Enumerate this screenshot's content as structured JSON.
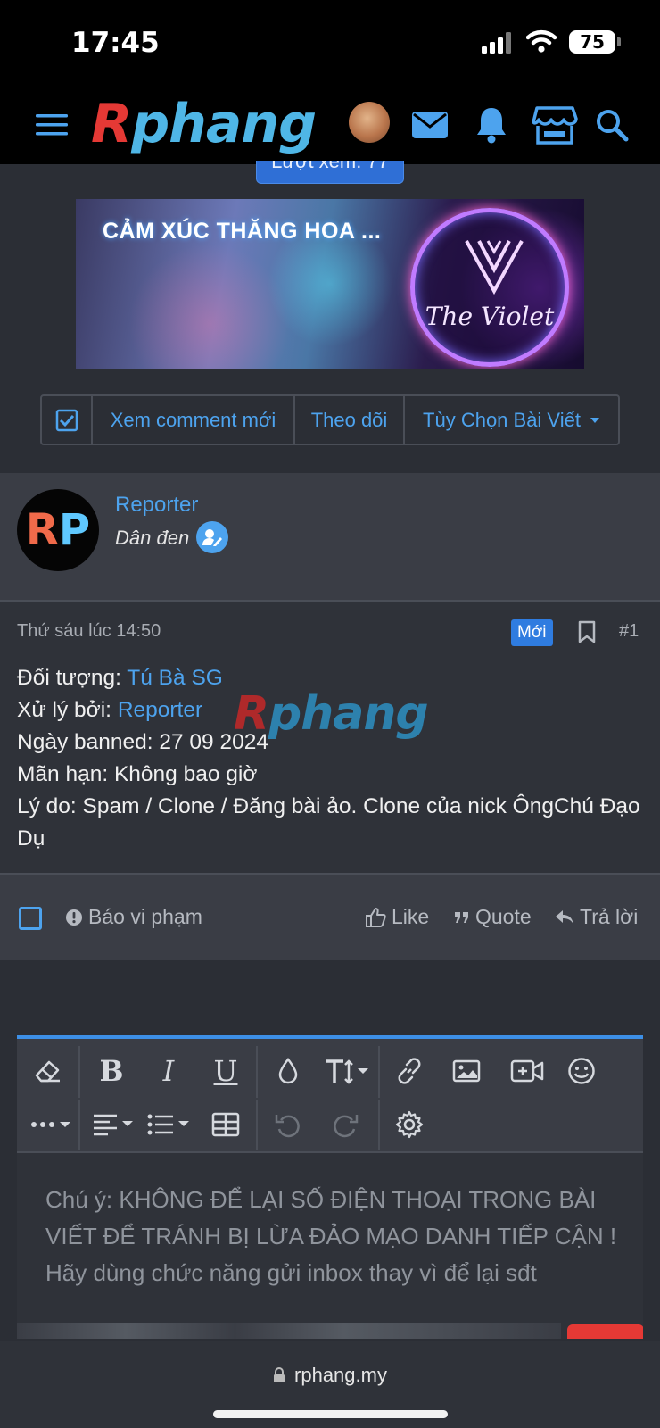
{
  "status_bar": {
    "time": "17:45",
    "battery": "75"
  },
  "nav": {
    "logo_r": "R",
    "logo_rest": "phang",
    "icons": [
      "menu-icon",
      "avatar",
      "mail-icon",
      "bell-icon",
      "store-icon",
      "search-icon"
    ],
    "accent": "#4da3ee"
  },
  "thread": {
    "views_label": "Lượt xem: 77"
  },
  "banner": {
    "headline": "CẢM XÚC THĂNG HOA ...",
    "brand": "The Violet"
  },
  "thread_actions": {
    "new_comments": "Xem comment mới",
    "follow": "Theo dõi",
    "options": "Tùy Chọn Bài Viết"
  },
  "post": {
    "author": "Reporter",
    "author_title": "Dân đen",
    "avatar_initials_1": "R",
    "avatar_initials_2": "P",
    "date": "Thứ sáu lúc 14:50",
    "new_badge": "Mới",
    "number": "#1",
    "lines": {
      "target_label": "Đối tượng: ",
      "target_value": "Tú Bà SG",
      "handled_label": "Xử lý bởi: ",
      "handled_value": "Reporter",
      "banned": "Ngày banned: 27 09 2024",
      "expiry": "Mãn hạn: Không bao giờ",
      "reason": "Lý do: Spam / Clone / Đăng bài ảo. Clone của nick ÔngChú Đạo Dụ"
    },
    "watermark_r": "R",
    "watermark_rest": "phang",
    "footer": {
      "report": "Báo vi phạm",
      "like": "Like",
      "quote": "Quote",
      "reply": "Trả lời"
    }
  },
  "editor": {
    "placeholder_1": "Chú ý: KHÔNG ĐỂ LẠI SỐ ĐIỆN THOẠI TRONG BÀI VIẾT ĐỂ TRÁNH BỊ LỪA ĐẢO MẠO DANH TIẾP CẬN !",
    "placeholder_2": "Hãy dùng chức năng gửi inbox thay vì để lại sđt",
    "bold": "B",
    "italic": "I",
    "underline": "U"
  },
  "browser": {
    "url": "rphang.my"
  }
}
